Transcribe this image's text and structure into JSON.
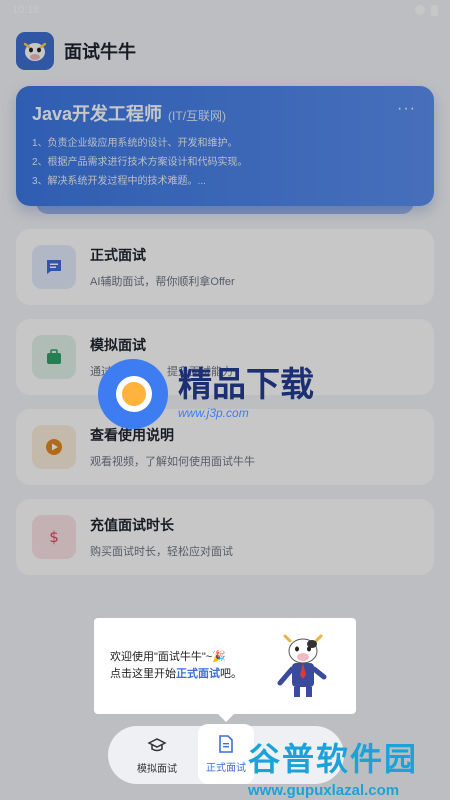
{
  "status": {
    "time": "10:18"
  },
  "app": {
    "title": "面试牛牛"
  },
  "job_card": {
    "title": "Java开发工程师",
    "tag": "(IT/互联网)",
    "more": "···",
    "lines": [
      "1、负责企业级应用系统的设计、开发和维护。",
      "2、根据产品需求进行技术方案设计和代码实现。",
      "3、解决系统开发过程中的技术难题。..."
    ]
  },
  "menu": [
    {
      "title": "正式面试",
      "subtitle": "AI辅助面试，帮你顺利拿Offer",
      "icon": "chat-icon",
      "color": "#3d6fd8"
    },
    {
      "title": "模拟面试",
      "subtitle": "通过模拟面试，提升面试能力",
      "icon": "briefcase-icon",
      "color": "#2fa36a"
    },
    {
      "title": "查看使用说明",
      "subtitle": "观看视频，了解如何使用面试牛牛",
      "icon": "play-icon",
      "color": "#e08a1e"
    },
    {
      "title": "充值面试时长",
      "subtitle": "购买面试时长，轻松应对面试",
      "icon": "dollar-icon",
      "color": "#e0455d"
    }
  ],
  "watermark": {
    "text": "精品下载",
    "url": "www.j3p.com"
  },
  "tooltip": {
    "line1": "欢迎使用\"面试牛牛\"~🎉",
    "line2_prefix": "点击这里开始",
    "line2_link": "正式面试",
    "line2_suffix": "吧。"
  },
  "bottom_nav": {
    "mock_label": "模拟面试",
    "formal_label": "正式面试"
  },
  "brand": {
    "name": "谷普软件园",
    "url": "www.gupuxlazal.com"
  }
}
